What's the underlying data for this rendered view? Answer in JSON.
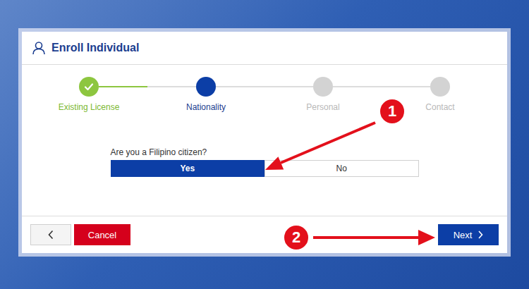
{
  "window": {
    "title": "Enroll Individual"
  },
  "steps": [
    {
      "label": "Existing License",
      "completed": true,
      "selected": false
    },
    {
      "label": "Nationality",
      "completed": false,
      "selected": true
    },
    {
      "label": "Personal",
      "completed": false,
      "selected": false
    },
    {
      "label": "Contact",
      "completed": false,
      "selected": false
    }
  ],
  "question": {
    "label": "Are you a Filipino citizen?",
    "options": [
      {
        "label": "Yes",
        "selected": true
      },
      {
        "label": "No",
        "selected": false
      }
    ]
  },
  "buttons": {
    "cancel": "Cancel",
    "next": "Next"
  },
  "annotations": [
    {
      "label": "1"
    },
    {
      "label": "2"
    }
  ]
}
